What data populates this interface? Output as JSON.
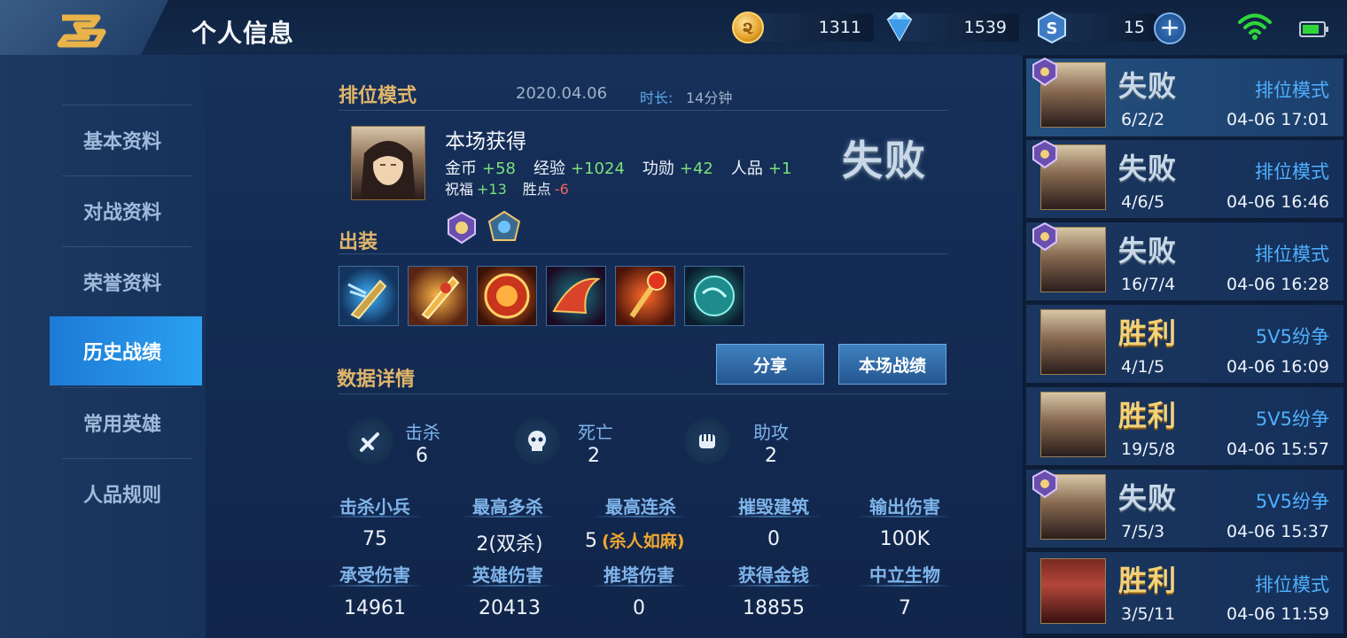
{
  "header": {
    "title": "个人信息",
    "gold": "1311",
    "diamonds": "1539",
    "vouchers": "15",
    "gold_icon_glyph": "૨"
  },
  "sidebar": {
    "items": [
      {
        "label": "基本资料"
      },
      {
        "label": "对战资料"
      },
      {
        "label": "荣誉资料"
      },
      {
        "label": "历史战绩"
      },
      {
        "label": "常用英雄"
      },
      {
        "label": "人品规则"
      }
    ],
    "active_index": 3
  },
  "match": {
    "mode": "排位模式",
    "date": "2020.04.06",
    "duration_label": "时长:",
    "duration_value": "14分钟",
    "rewards_title": "本场获得",
    "gold_label": "金币",
    "gold_value": "+58",
    "exp_label": "经验",
    "exp_value": "+1024",
    "merit_label": "功勋",
    "merit_value": "+42",
    "rp_label": "人品",
    "rp_value": "+1",
    "bless_label": "祝福",
    "bless_value": "+13",
    "winpt_label": "胜点",
    "winpt_value": "-6",
    "result": "失败"
  },
  "equipment": {
    "title": "出装",
    "items": [
      "arrow-gauntlet-item",
      "golden-blade-item",
      "red-orb-item",
      "phoenix-wing-item",
      "red-staff-item",
      "teal-stone-item"
    ]
  },
  "details": {
    "title": "数据详情",
    "share_label": "分享",
    "scoreboard_label": "本场战绩",
    "kills_label": "击杀",
    "kills_value": "6",
    "deaths_label": "死亡",
    "deaths_value": "2",
    "assists_label": "助攻",
    "assists_value": "2",
    "stats_row1": [
      {
        "label": "击杀小兵",
        "value": "75"
      },
      {
        "label": "最高多杀",
        "value": "2(双杀)"
      },
      {
        "label": "最高连杀",
        "value": "5",
        "extra": "(杀人如麻)"
      },
      {
        "label": "摧毁建筑",
        "value": "0"
      },
      {
        "label": "输出伤害",
        "value": "100K"
      }
    ],
    "stats_row2": [
      {
        "label": "承受伤害",
        "value": "14961"
      },
      {
        "label": "英雄伤害",
        "value": "20413"
      },
      {
        "label": "推塔伤害",
        "value": "0"
      },
      {
        "label": "获得金钱",
        "value": "18855"
      },
      {
        "label": "中立生物",
        "value": "7"
      }
    ]
  },
  "history": [
    {
      "result": "失败",
      "outcome": "lose",
      "mode": "排位模式",
      "kda": "6/2/2",
      "time": "04-06 17:01"
    },
    {
      "result": "失败",
      "outcome": "lose",
      "mode": "排位模式",
      "kda": "4/6/5",
      "time": "04-06 16:46"
    },
    {
      "result": "失败",
      "outcome": "lose",
      "mode": "排位模式",
      "kda": "16/7/4",
      "time": "04-06 16:28"
    },
    {
      "result": "胜利",
      "outcome": "win",
      "mode": "5V5纷争",
      "kda": "4/1/5",
      "time": "04-06 16:09"
    },
    {
      "result": "胜利",
      "outcome": "win",
      "mode": "5V5纷争",
      "kda": "19/5/8",
      "time": "04-06 15:57"
    },
    {
      "result": "失败",
      "outcome": "lose",
      "mode": "5V5纷争",
      "kda": "7/5/3",
      "time": "04-06 15:37"
    },
    {
      "result": "胜利",
      "outcome": "win",
      "mode": "排位模式",
      "kda": "3/5/11",
      "time": "04-06 11:59"
    }
  ],
  "colors": {
    "accent": "#2aa0f0",
    "section_title": "#e0b66a",
    "positive": "#7be07b",
    "negative": "#f06565",
    "mode_blue": "#4fb0ff"
  }
}
